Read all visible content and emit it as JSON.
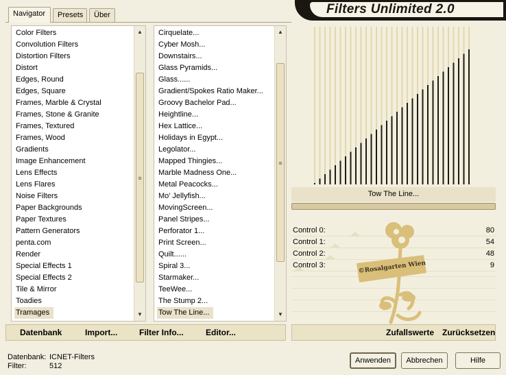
{
  "title": "Filters Unlimited 2.0",
  "tabs": [
    "Navigator",
    "Presets",
    "Über"
  ],
  "categories": [
    "Color Filters",
    "Convolution Filters",
    "Distortion Filters",
    "Distort",
    "Edges, Round",
    "Edges, Square",
    "Frames, Marble & Crystal",
    "Frames, Stone & Granite",
    "Frames, Textured",
    "Frames, Wood",
    "Gradients",
    "Image Enhancement",
    "Lens Effects",
    "Lens Flares",
    "Noise Filters",
    "Paper Backgrounds",
    "Paper Textures",
    "Pattern Generators",
    "penta.com",
    "Render",
    "Special Effects 1",
    "Special Effects 2",
    "Tile & Mirror",
    "Toadies",
    "Tramages"
  ],
  "selected_category": "Tramages",
  "filters": [
    "Cirquelate...",
    "Cyber Mosh...",
    "Downstairs...",
    "Glass Pyramids...",
    "Glass......",
    "Gradient/Spokes Ratio Maker...",
    "Groovy Bachelor Pad...",
    "Heightline...",
    "Hex Lattice...",
    "Holidays in Egypt...",
    "Legolator...",
    "Mapped Thingies...",
    "Marble Madness One...",
    "Metal Peacocks...",
    "Mo' Jellyfish...",
    "MovingScreen...",
    "Panel Stripes...",
    "Perforator 1...",
    "Print Screen...",
    "Quilt......",
    "Spiral 3...",
    "Starmaker...",
    "TeeWee...",
    "The Stump 2...",
    "Tow The Line..."
  ],
  "selected_filter": "Tow The Line...",
  "preview_filter_name": "Tow The Line...",
  "controls": [
    {
      "label": "Control 0:",
      "value": "80"
    },
    {
      "label": "Control 1:",
      "value": "54"
    },
    {
      "label": "Control 2:",
      "value": "48"
    },
    {
      "label": "Control 3:",
      "value": "9"
    }
  ],
  "watermark_text": "©Rosalgarten Wien",
  "bottom_left_links": [
    "Datenbank",
    "Import...",
    "Filter Info...",
    "Editor..."
  ],
  "bottom_right_links": [
    "Zufallswerte",
    "Zurücksetzen"
  ],
  "status": {
    "database_label": "Datenbank:",
    "database_value": "ICNET-Filters",
    "filter_label": "Filter:",
    "filter_value": "512"
  },
  "buttons": {
    "apply": "Anwenden",
    "cancel": "Abbrechen",
    "help": "Hilfe"
  },
  "colors": {
    "accent_dark": "#1a1713",
    "panel": "#f2eee0",
    "gold": "#d9bf7a"
  },
  "icons": [
    "scroll-up-icon",
    "scroll-down-icon",
    "scroll-thumb-grip-icon",
    "rose-watermark-icon"
  ]
}
